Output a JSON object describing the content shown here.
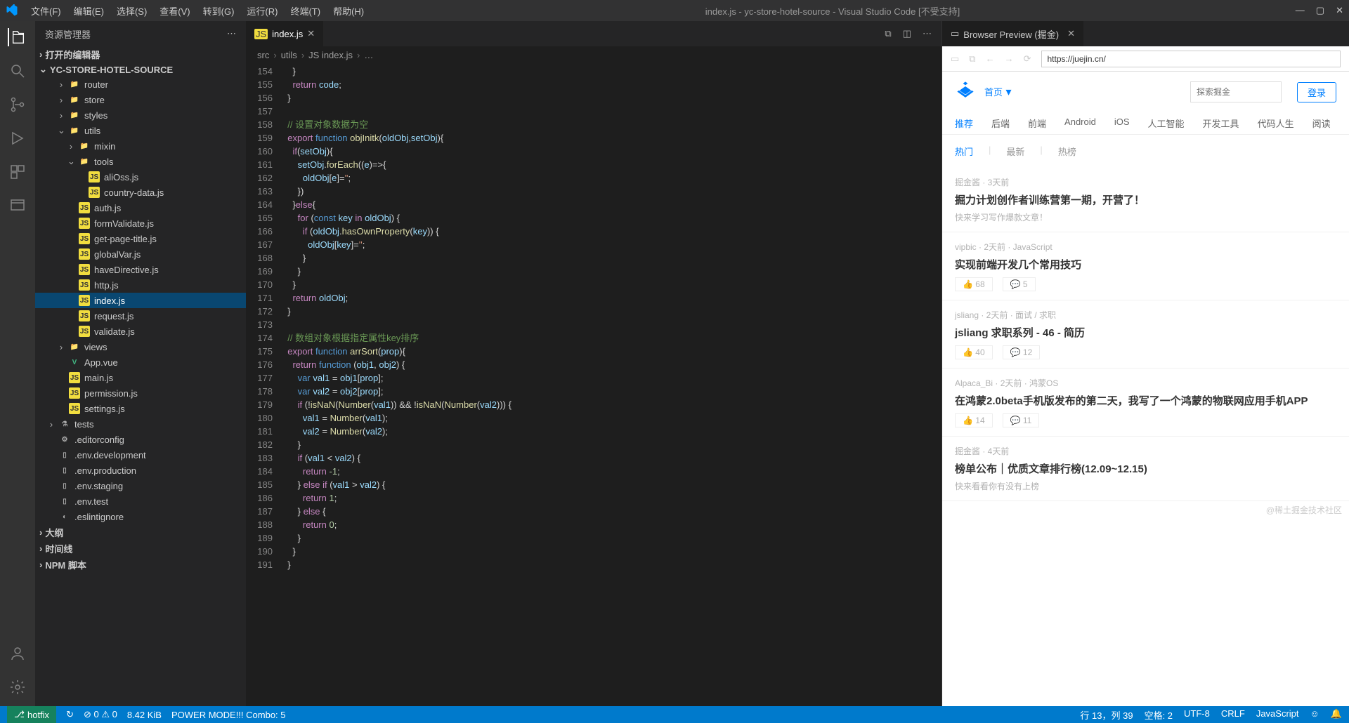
{
  "titlebar": {
    "menus": [
      "文件(F)",
      "编辑(E)",
      "选择(S)",
      "查看(V)",
      "转到(G)",
      "运行(R)",
      "终端(T)",
      "帮助(H)"
    ],
    "title": "index.js - yc-store-hotel-source - Visual Studio Code [不受支持]"
  },
  "sidebar": {
    "header": "资源管理器",
    "editors_section": "打开的编辑器",
    "project": "YC-STORE-HOTEL-SOURCE",
    "outline": "大纲",
    "timeline": "时间线",
    "npm": "NPM 脚本",
    "tree": [
      {
        "indent": 1,
        "chev": "›",
        "icon": "folder",
        "label": "router"
      },
      {
        "indent": 1,
        "chev": "›",
        "icon": "folder",
        "label": "store"
      },
      {
        "indent": 1,
        "chev": "›",
        "icon": "folder-blue",
        "label": "styles"
      },
      {
        "indent": 1,
        "chev": "⌄",
        "icon": "folder-util",
        "label": "utils"
      },
      {
        "indent": 2,
        "chev": "›",
        "icon": "folder",
        "label": "mixin"
      },
      {
        "indent": 2,
        "chev": "⌄",
        "icon": "folder-util",
        "label": "tools"
      },
      {
        "indent": 3,
        "chev": "",
        "icon": "js",
        "label": "aliOss.js"
      },
      {
        "indent": 3,
        "chev": "",
        "icon": "js",
        "label": "country-data.js"
      },
      {
        "indent": 2,
        "chev": "",
        "icon": "js",
        "label": "auth.js"
      },
      {
        "indent": 2,
        "chev": "",
        "icon": "js",
        "label": "formValidate.js"
      },
      {
        "indent": 2,
        "chev": "",
        "icon": "js",
        "label": "get-page-title.js"
      },
      {
        "indent": 2,
        "chev": "",
        "icon": "js",
        "label": "globalVar.js"
      },
      {
        "indent": 2,
        "chev": "",
        "icon": "js",
        "label": "haveDirective.js"
      },
      {
        "indent": 2,
        "chev": "",
        "icon": "js",
        "label": "http.js"
      },
      {
        "indent": 2,
        "chev": "",
        "icon": "js",
        "label": "index.js",
        "selected": true
      },
      {
        "indent": 2,
        "chev": "",
        "icon": "js",
        "label": "request.js"
      },
      {
        "indent": 2,
        "chev": "",
        "icon": "js",
        "label": "validate.js"
      },
      {
        "indent": 1,
        "chev": "›",
        "icon": "folder-red",
        "label": "views"
      },
      {
        "indent": 1,
        "chev": "",
        "icon": "vue",
        "label": "App.vue"
      },
      {
        "indent": 1,
        "chev": "",
        "icon": "js",
        "label": "main.js"
      },
      {
        "indent": 1,
        "chev": "",
        "icon": "js",
        "label": "permission.js"
      },
      {
        "indent": 1,
        "chev": "",
        "icon": "js",
        "label": "settings.js"
      },
      {
        "indent": 0,
        "chev": "›",
        "icon": "test",
        "label": "tests"
      },
      {
        "indent": 0,
        "chev": "",
        "icon": "cfg",
        "label": ".editorconfig"
      },
      {
        "indent": 0,
        "chev": "",
        "icon": "file",
        "label": ".env.development"
      },
      {
        "indent": 0,
        "chev": "",
        "icon": "file",
        "label": ".env.production"
      },
      {
        "indent": 0,
        "chev": "",
        "icon": "file",
        "label": ".env.staging"
      },
      {
        "indent": 0,
        "chev": "",
        "icon": "file",
        "label": ".env.test"
      },
      {
        "indent": 0,
        "chev": "",
        "icon": "eslint",
        "label": ".eslintignore"
      }
    ]
  },
  "editor": {
    "tab": {
      "icon": "JS",
      "label": "index.js"
    },
    "breadcrumbs": [
      "src",
      "utils",
      "JS index.js",
      "…"
    ],
    "first_line": 154,
    "code_lines": [
      "    <span class='tok-pn'>}</span>",
      "    <span class='tok-kw'>return</span> <span class='tok-var'>code</span>;",
      "  <span class='tok-pn'>}</span>",
      "",
      "  <span class='tok-cmt'>// 设置对象数据为空</span>",
      "  <span class='tok-kw'>export</span> <span class='tok-blue'>function</span> <span class='tok-fn'>objInitk</span>(<span class='tok-var'>oldObj</span>,<span class='tok-var'>setObj</span>){",
      "    <span class='tok-kw'>if</span>(<span class='tok-var'>setObj</span>){",
      "      <span class='tok-var'>setObj</span>.<span class='tok-fn'>forEach</span>((<span class='tok-var'>e</span>)=&gt;{",
      "        <span class='tok-var'>oldObj</span>[<span class='tok-var'>e</span>]=<span class='tok-str'>''</span>;",
      "      })",
      "    }<span class='tok-kw'>else</span>{",
      "      <span class='tok-kw'>for</span> (<span class='tok-blue'>const</span> <span class='tok-var'>key</span> <span class='tok-kw'>in</span> <span class='tok-var'>oldObj</span>) {",
      "        <span class='tok-kw'>if</span> (<span class='tok-var'>oldObj</span>.<span class='tok-fn'>hasOwnProperty</span>(<span class='tok-var'>key</span>)) {",
      "          <span class='tok-var'>oldObj</span>[<span class='tok-var'>key</span>]=<span class='tok-str'>''</span>;",
      "        }",
      "      }",
      "    }",
      "    <span class='tok-kw'>return</span> <span class='tok-var'>oldObj</span>;",
      "  }",
      "",
      "  <span class='tok-cmt'>// 数组对象根据指定属性key排序</span>",
      "  <span class='tok-kw'>export</span> <span class='tok-blue'>function</span> <span class='tok-fn'>arrSort</span>(<span class='tok-var'>prop</span>){",
      "    <span class='tok-kw'>return</span> <span class='tok-blue'>function</span> (<span class='tok-var'>obj1</span>, <span class='tok-var'>obj2</span>) {",
      "      <span class='tok-blue'>var</span> <span class='tok-var'>val1</span> = <span class='tok-var'>obj1</span>[<span class='tok-var'>prop</span>];",
      "      <span class='tok-blue'>var</span> <span class='tok-var'>val2</span> = <span class='tok-var'>obj2</span>[<span class='tok-var'>prop</span>];",
      "      <span class='tok-kw'>if</span> (!<span class='tok-fn'>isNaN</span>(<span class='tok-fn'>Number</span>(<span class='tok-var'>val1</span>)) &amp;&amp; !<span class='tok-fn'>isNaN</span>(<span class='tok-fn'>Number</span>(<span class='tok-var'>val2</span>))) {",
      "        <span class='tok-var'>val1</span> = <span class='tok-fn'>Number</span>(<span class='tok-var'>val1</span>);",
      "        <span class='tok-var'>val2</span> = <span class='tok-fn'>Number</span>(<span class='tok-var'>val2</span>);",
      "      }",
      "      <span class='tok-kw'>if</span> (<span class='tok-var'>val1</span> &lt; <span class='tok-var'>val2</span>) {",
      "        <span class='tok-kw'>return</span> <span class='tok-num'>-1</span>;",
      "      } <span class='tok-kw'>else if</span> (<span class='tok-var'>val1</span> &gt; <span class='tok-var'>val2</span>) {",
      "        <span class='tok-kw'>return</span> <span class='tok-num'>1</span>;",
      "      } <span class='tok-kw'>else</span> {",
      "        <span class='tok-kw'>return</span> <span class='tok-num'>0</span>;",
      "      }",
      "    }",
      "  }"
    ]
  },
  "browser": {
    "tab_title": "Browser Preview (掘金)",
    "url": "https://juejin.cn/",
    "top": {
      "home": "首页",
      "search_ph": "探索掘金",
      "login": "登录"
    },
    "nav": [
      "推荐",
      "后端",
      "前端",
      "Android",
      "iOS",
      "人工智能",
      "开发工具",
      "代码人生",
      "阅读"
    ],
    "filter": [
      "热门",
      "最新",
      "热榜"
    ],
    "posts": [
      {
        "meta": "掘金酱 · 3天前",
        "title": "掘力计划创作者训练营第一期，开营了！",
        "sub": "快来学习写作爆款文章！",
        "likes": "",
        "comments": ""
      },
      {
        "meta": "vipbic · 2天前 · JavaScript",
        "title": "实现前端开发几个常用技巧",
        "sub": "",
        "likes": "68",
        "comments": "5"
      },
      {
        "meta": "jsliang · 2天前 · 面试 / 求职",
        "title": "jsliang 求职系列 - 46 - 简历",
        "sub": "",
        "likes": "40",
        "comments": "12"
      },
      {
        "meta": "Alpaca_Bi · 2天前 · 鸿蒙OS",
        "title": "在鸿蒙2.0beta手机版发布的第二天，我写了一个鸿蒙的物联网应用手机APP",
        "sub": "",
        "likes": "14",
        "comments": "11"
      },
      {
        "meta": "掘金酱 · 4天前",
        "title": "榜单公布｜优质文章排行榜(12.09~12.15)",
        "sub": "快来看看你有没有上榜",
        "likes": "",
        "comments": ""
      }
    ],
    "watermark": "@稀土掘金技术社区"
  },
  "statusbar": {
    "branch": "hotfix",
    "sync": "↻",
    "problems": "⊘ 0 ⚠ 0",
    "size": "8.42 KiB",
    "power": "POWER MODE!!! Combo: 5",
    "pos": "行 13，列 39",
    "spaces": "空格: 2",
    "enc": "UTF-8",
    "eol": "CRLF",
    "lang": "JavaScript"
  }
}
